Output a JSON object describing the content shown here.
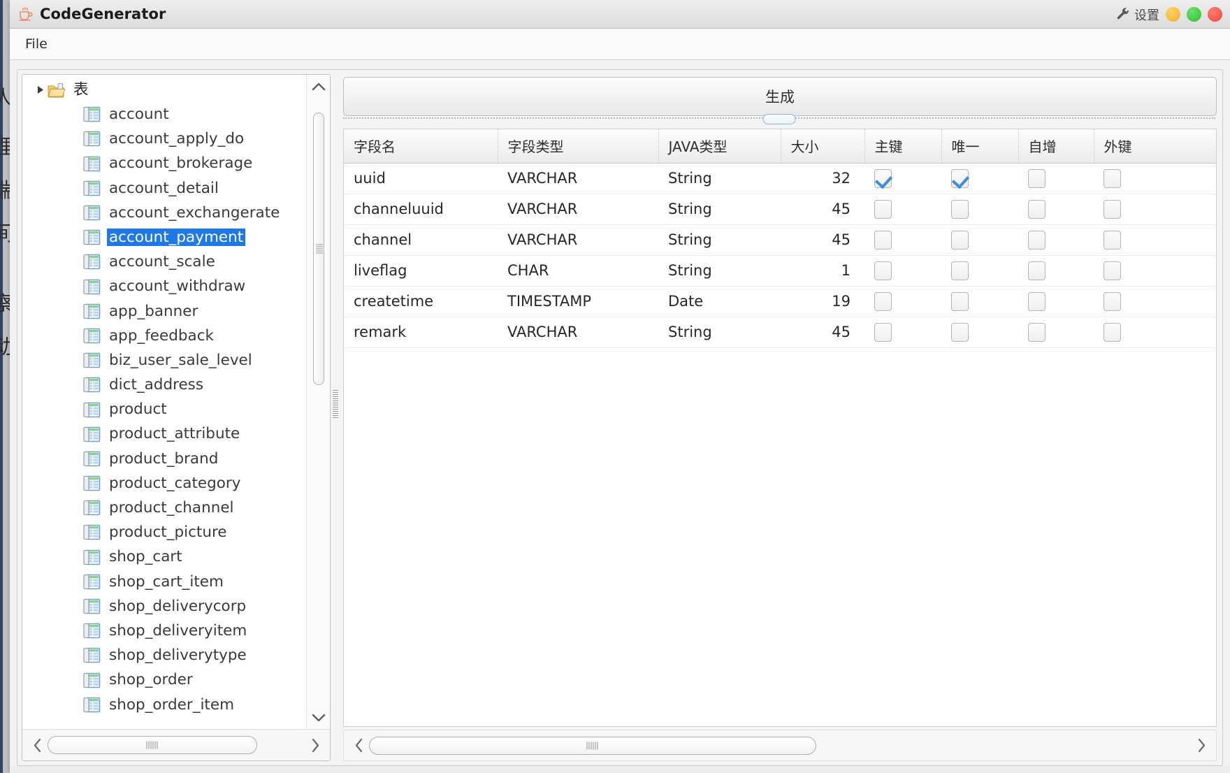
{
  "window": {
    "title": "CodeGenerator",
    "app_icon": "coffee-cup-icon",
    "settings_label": "设置",
    "settings_icon": "wrench-icon",
    "buttons": {
      "minimize": "minimize-dot",
      "maximize": "maximize-dot",
      "close": "close-dot"
    },
    "colors": {
      "minimize": "#f4b93c",
      "maximize": "#3ecb3e",
      "close": "#f5544b",
      "selection": "#1e79e6",
      "checkmark": "#3d8fdd",
      "title_icon": "#f1886f"
    }
  },
  "menu": {
    "items": [
      {
        "label": "File"
      }
    ]
  },
  "tree": {
    "root": {
      "label": "表",
      "expanded": true,
      "icon": "open-folder-icon"
    },
    "selected": "account_payment",
    "items": [
      {
        "label": "account"
      },
      {
        "label": "account_apply_do"
      },
      {
        "label": "account_brokerage"
      },
      {
        "label": "account_detail"
      },
      {
        "label": "account_exchangerate"
      },
      {
        "label": "account_payment"
      },
      {
        "label": "account_scale"
      },
      {
        "label": "account_withdraw"
      },
      {
        "label": "app_banner"
      },
      {
        "label": "app_feedback"
      },
      {
        "label": "biz_user_sale_level"
      },
      {
        "label": "dict_address"
      },
      {
        "label": "product"
      },
      {
        "label": "product_attribute"
      },
      {
        "label": "product_brand"
      },
      {
        "label": "product_category"
      },
      {
        "label": "product_channel"
      },
      {
        "label": "product_picture"
      },
      {
        "label": "shop_cart"
      },
      {
        "label": "shop_cart_item"
      },
      {
        "label": "shop_deliverycorp"
      },
      {
        "label": "shop_deliveryitem"
      },
      {
        "label": "shop_deliverytype"
      },
      {
        "label": "shop_order"
      },
      {
        "label": "shop_order_item"
      }
    ]
  },
  "right": {
    "generate_button": "生成",
    "table": {
      "columns": [
        "字段名",
        "字段类型",
        "JAVA类型",
        "大小",
        "主键",
        "唯一",
        "自增",
        "外键"
      ],
      "rows": [
        {
          "field": "uuid",
          "type": "VARCHAR",
          "java": "String",
          "size": "32",
          "pk": true,
          "unique": true,
          "auto": false,
          "fk": false
        },
        {
          "field": "channeluuid",
          "type": "VARCHAR",
          "java": "String",
          "size": "45",
          "pk": false,
          "unique": false,
          "auto": false,
          "fk": false
        },
        {
          "field": "channel",
          "type": "VARCHAR",
          "java": "String",
          "size": "45",
          "pk": false,
          "unique": false,
          "auto": false,
          "fk": false
        },
        {
          "field": "liveflag",
          "type": "CHAR",
          "java": "String",
          "size": "1",
          "pk": false,
          "unique": false,
          "auto": false,
          "fk": false
        },
        {
          "field": "createtime",
          "type": "TIMESTAMP",
          "java": "Date",
          "size": "19",
          "pk": false,
          "unique": false,
          "auto": false,
          "fk": false
        },
        {
          "field": "remark",
          "type": "VARCHAR",
          "java": "String",
          "size": "45",
          "pk": false,
          "unique": false,
          "auto": false,
          "fk": false
        }
      ]
    }
  },
  "background": {
    "ghost_chars": [
      "人",
      "理",
      "端",
      "间",
      "察",
      "动"
    ]
  }
}
